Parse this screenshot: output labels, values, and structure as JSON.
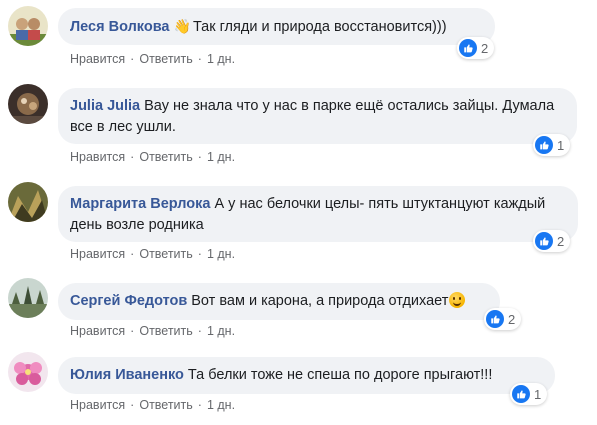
{
  "actions": {
    "like_label": "Нравится",
    "reply_label": "Ответить",
    "separator": "·"
  },
  "colors": {
    "author": "#385898",
    "bubble": "#f0f2f5",
    "like_blue": "#1877f2",
    "meta": "#65676b"
  },
  "comments": [
    {
      "author": "Леся Волкова",
      "icon_before_text": "wave-hand-icon",
      "text": "Так гляди и природа восстановится)))",
      "reaction_icon": "like-icon",
      "reaction_count": "2",
      "time": "1 дн."
    },
    {
      "author": "Julia Julia",
      "text": "Вау не знала что у нас в парке ещё остались зайцы. Думала все в лес ушли.",
      "reaction_icon": "like-icon",
      "reaction_count": "1",
      "time": "1 дн."
    },
    {
      "author": "Маргарита Верлока",
      "text": "А у нас белочки целы- пять штуктанцуют каждый день возле родника",
      "reaction_icon": "like-icon",
      "reaction_count": "2",
      "time": "1 дн."
    },
    {
      "author": "Сергей Федотов",
      "text": "Вот вам и карона, а природа отдихает",
      "icon_after_text": "smile-emoji-icon",
      "reaction_icon": "like-icon",
      "reaction_count": "2",
      "time": "1 дн."
    },
    {
      "author": "Юлия Иваненко",
      "text": "Та белки тоже не спеша по дороге прыгают!!!",
      "reaction_icon": "like-icon",
      "reaction_count": "1",
      "time": "1 дн."
    }
  ]
}
